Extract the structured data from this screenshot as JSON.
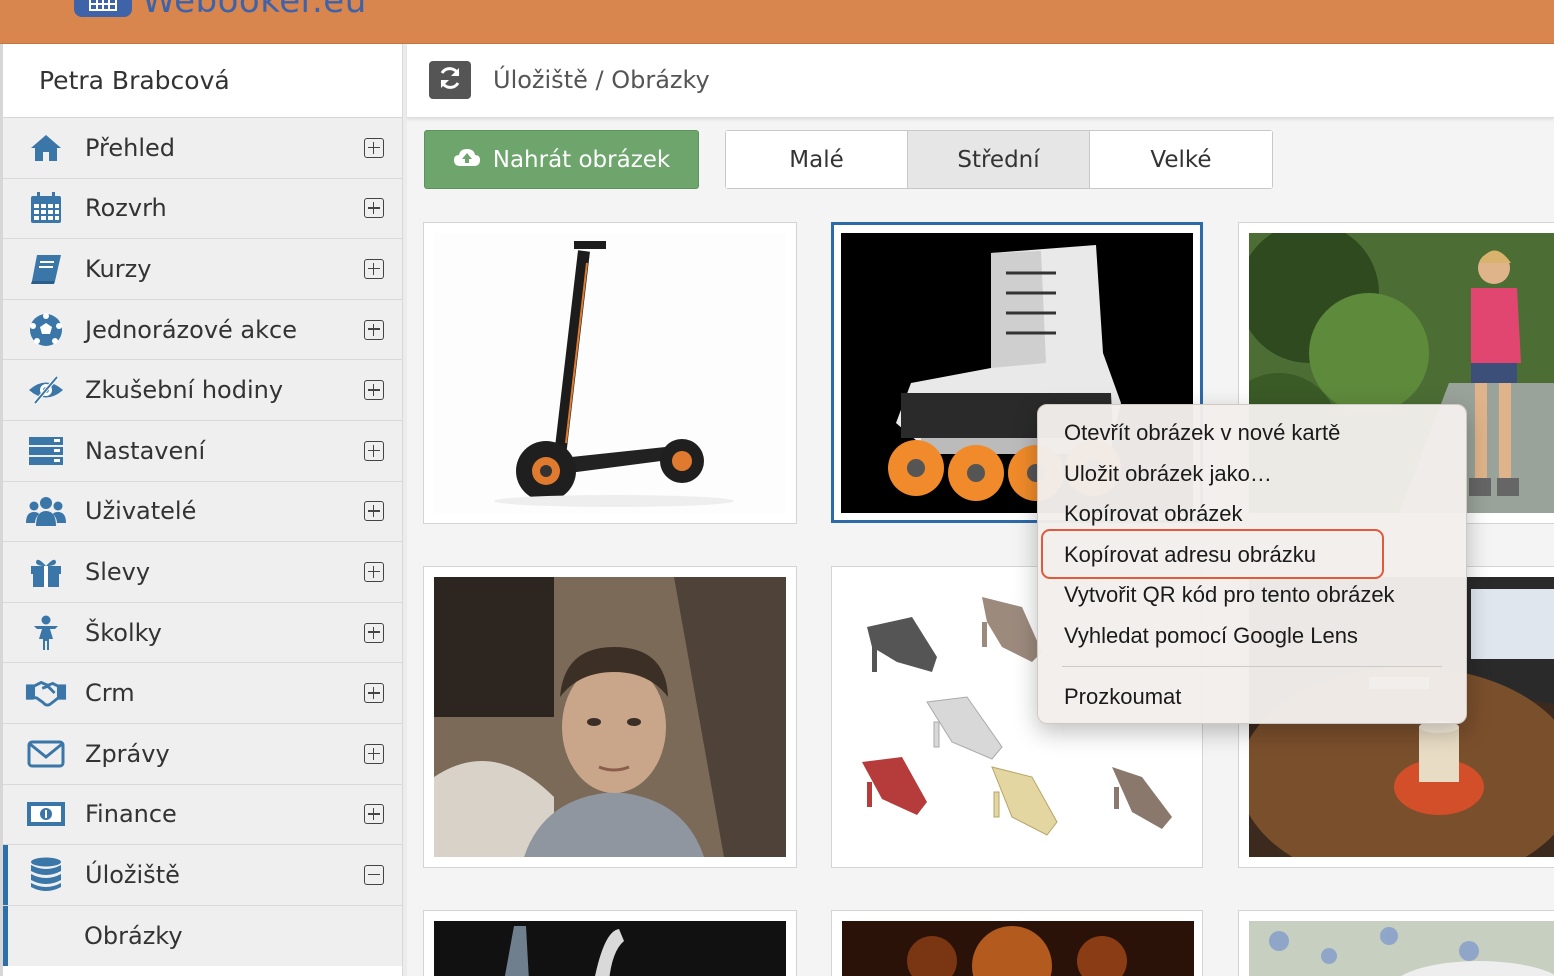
{
  "header": {
    "brand_name": "Webooker.eu",
    "brand_color": "#3f63a8",
    "bar_color": "#d9864e"
  },
  "sidebar": {
    "user_name": "Petra Brabcová",
    "items": [
      {
        "label": "Přehled",
        "icon": "home-icon",
        "expanded": false
      },
      {
        "label": "Rozvrh",
        "icon": "calendar-icon",
        "expanded": false
      },
      {
        "label": "Kurzy",
        "icon": "book-icon",
        "expanded": false
      },
      {
        "label": "Jednorázové akce",
        "icon": "soccer-ball-icon",
        "expanded": false
      },
      {
        "label": "Zkušební hodiny",
        "icon": "eye-slash-icon",
        "expanded": false
      },
      {
        "label": "Nastavení",
        "icon": "server-icon",
        "expanded": false
      },
      {
        "label": "Uživatelé",
        "icon": "users-icon",
        "expanded": false
      },
      {
        "label": "Slevy",
        "icon": "gift-icon",
        "expanded": false
      },
      {
        "label": "Školky",
        "icon": "child-icon",
        "expanded": false
      },
      {
        "label": "Crm",
        "icon": "handshake-icon",
        "expanded": false
      },
      {
        "label": "Zprávy",
        "icon": "envelope-icon",
        "expanded": false
      },
      {
        "label": "Finance",
        "icon": "money-bill-icon",
        "expanded": false
      },
      {
        "label": "Úložiště",
        "icon": "database-icon",
        "expanded": true
      }
    ],
    "sub_items": [
      {
        "label": "Obrázky"
      }
    ]
  },
  "main": {
    "breadcrumb": "Úložiště / Obrázky",
    "upload_label": "Nahrát obrázek",
    "size_options": [
      "Malé",
      "Střední",
      "Velké"
    ],
    "selected_size": "Střední"
  },
  "gallery": {
    "images": [
      {
        "name": "electric-scooter-image"
      },
      {
        "name": "inline-skate-image",
        "selected": true
      },
      {
        "name": "woman-rollerblading-image"
      },
      {
        "name": "man-portrait-image"
      },
      {
        "name": "dance-shoes-image"
      },
      {
        "name": "coffee-table-image"
      },
      {
        "name": "partial-image-7"
      },
      {
        "name": "partial-image-8"
      },
      {
        "name": "partial-image-9"
      }
    ]
  },
  "context_menu": {
    "items": [
      "Otevřít obrázek v nové kartě",
      "Uložit obrázek jako…",
      "Kopírovat obrázek",
      "Kopírovat adresu obrázku",
      "Vytvořit QR kód pro tento obrázek",
      "Vyhledat pomocí Google Lens"
    ],
    "inspect_label": "Prozkoumat",
    "highlighted_item": "Kopírovat adresu obrázku",
    "highlight_color": "#e05a3c"
  }
}
